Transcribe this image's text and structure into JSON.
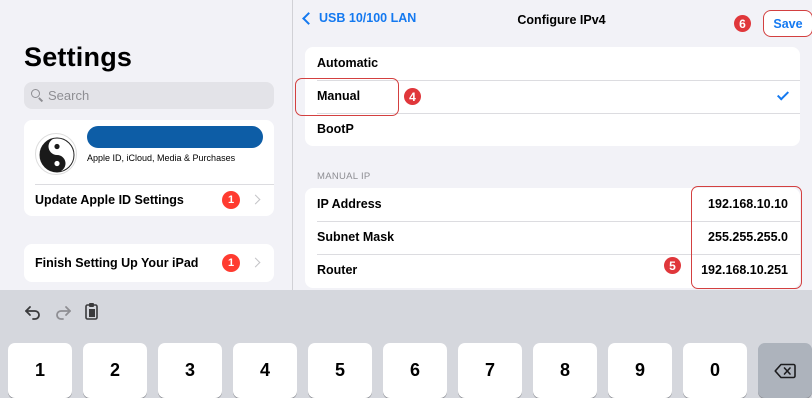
{
  "sidebar": {
    "title": "Settings",
    "search_placeholder": "Search",
    "profile_subtitle": "Apple ID, iCloud, Media & Purchases",
    "update_apple_id": {
      "label": "Update Apple ID Settings",
      "badge": "1"
    },
    "finish_setup": {
      "label": "Finish Setting Up Your iPad",
      "badge": "1"
    }
  },
  "navbar": {
    "back_label": "USB 10/100 LAN",
    "title": "Configure IPv4",
    "save_label": "Save"
  },
  "config_options": [
    {
      "label": "Automatic",
      "selected": false
    },
    {
      "label": "Manual",
      "selected": true
    },
    {
      "label": "BootP",
      "selected": false
    }
  ],
  "manual_ip": {
    "section_header": "MANUAL IP",
    "fields": [
      {
        "label": "IP Address",
        "value": "192.168.10.10"
      },
      {
        "label": "Subnet Mask",
        "value": "255.255.255.0"
      },
      {
        "label": "Router",
        "value": "192.168.10.251"
      }
    ]
  },
  "annotations": {
    "manual": "4",
    "fields": "5",
    "save": "6"
  },
  "keyboard": {
    "keys": [
      "1",
      "2",
      "3",
      "4",
      "5",
      "6",
      "7",
      "8",
      "9",
      "0"
    ],
    "toolbar_icons": [
      "undo-icon",
      "redo-icon",
      "paste-icon"
    ]
  },
  "colors": {
    "accent": "#1479f0",
    "badge": "#ff3b30",
    "annotation": "#e0373b",
    "profile_bar": "#0d5da6"
  }
}
